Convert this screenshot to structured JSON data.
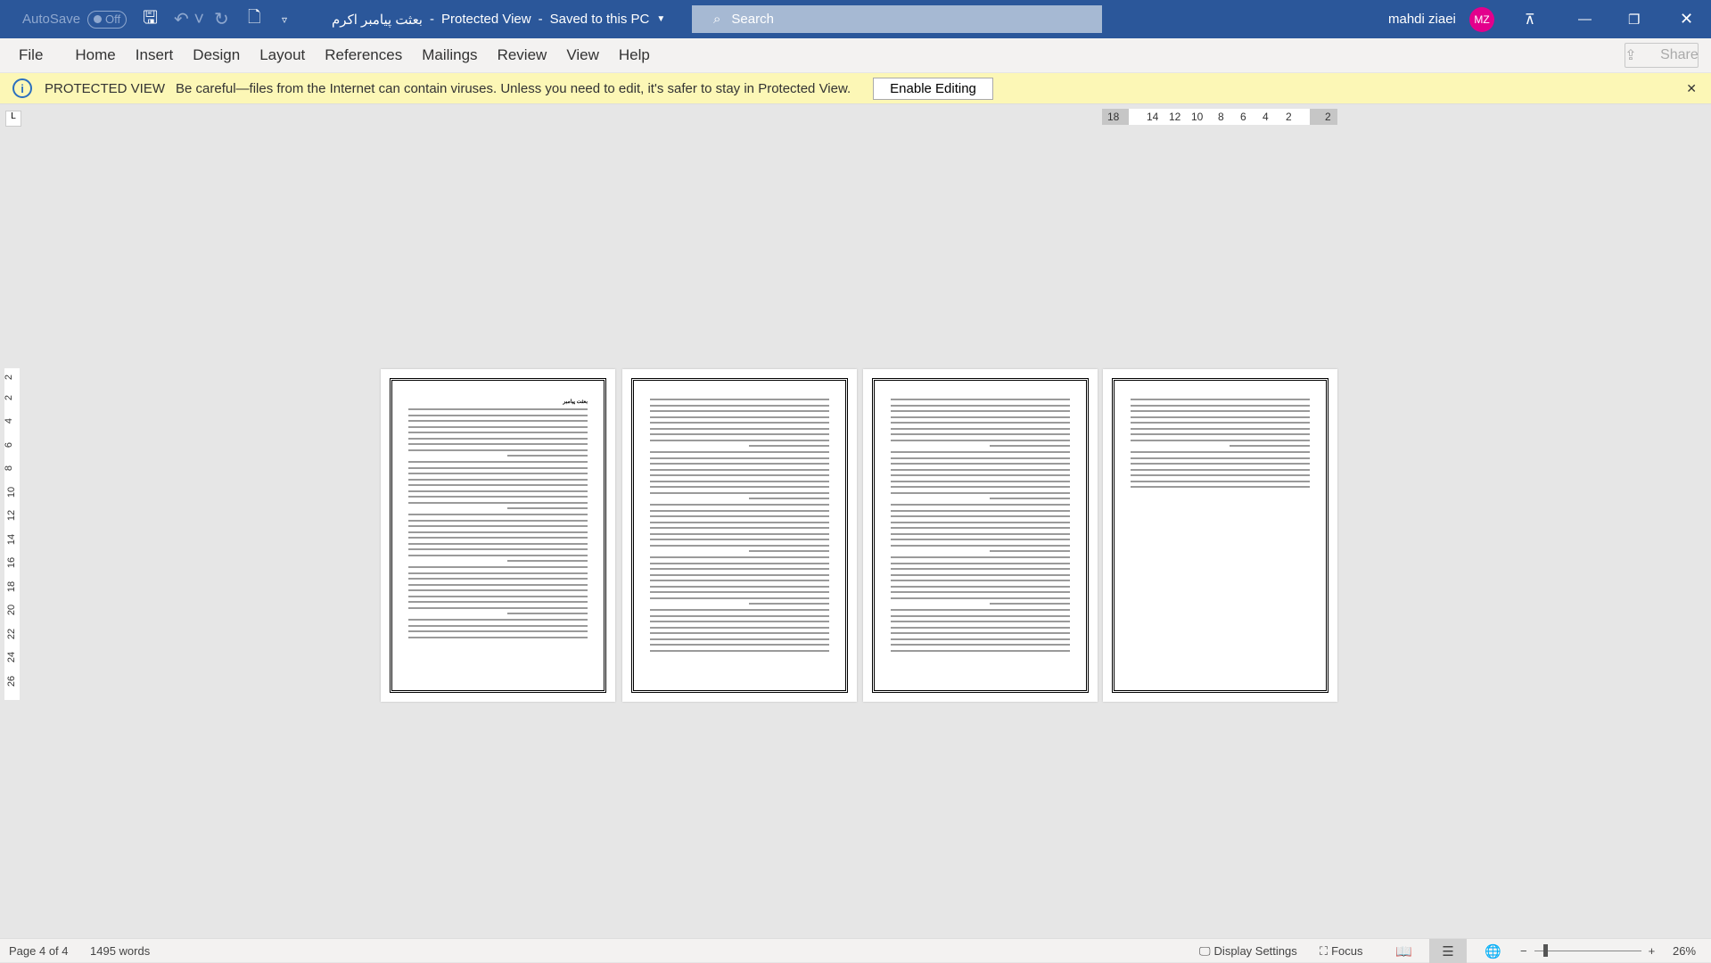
{
  "titlebar": {
    "autosave": "AutoSave",
    "autosave_state": "Off",
    "doc_title": "بعثت پیامبر اکرم",
    "mode": "Protected View",
    "save_state": "Saved to this PC",
    "search_placeholder": "Search",
    "user": "mahdi ziaei",
    "initials": "MZ"
  },
  "menu": [
    "File",
    "Home",
    "Insert",
    "Design",
    "Layout",
    "References",
    "Mailings",
    "Review",
    "View",
    "Help"
  ],
  "share": "Share",
  "protected": {
    "label": "PROTECTED VIEW",
    "message": "Be careful—files from the Internet can contain viruses. Unless you need to edit, it's safer to stay in Protected View.",
    "button": "Enable Editing"
  },
  "ruler": {
    "h": [
      "18",
      "14",
      "12",
      "10",
      "8",
      "6",
      "4",
      "2",
      "2"
    ],
    "v": [
      "2",
      "2",
      "4",
      "6",
      "8",
      "10",
      "12",
      "14",
      "16",
      "18",
      "20",
      "22",
      "24",
      "26"
    ]
  },
  "pages": {
    "title": "بعثت پیامبر"
  },
  "status": {
    "page": "Page 4 of 4",
    "words": "1495 words",
    "display": "Display Settings",
    "focus": "Focus",
    "zoom": "26%",
    "zoom_level": 26
  },
  "colors": {
    "titlebar": "#2b579a",
    "avatar": "#e3008c",
    "protected_bar": "#fcf7b6"
  }
}
